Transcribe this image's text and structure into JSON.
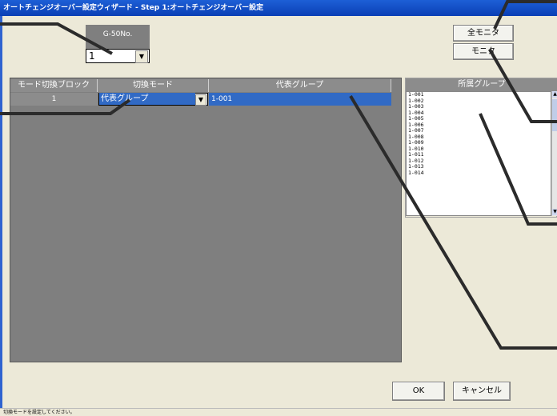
{
  "window": {
    "title": "オートチェンジオーバー設定ウィザード - Step 1:オートチェンジオーバー設定"
  },
  "g50": {
    "label": "G-50No.",
    "selected": "1"
  },
  "buttons": {
    "all_monitor": "全モニタ",
    "monitor": "モニタ",
    "ok": "OK",
    "cancel": "キャンセル"
  },
  "grid": {
    "headers": [
      "モード切換ブロック",
      "切換モード",
      "代表グループ"
    ],
    "rows": [
      {
        "block": "1",
        "mode": "代表グループ",
        "group": "1-001"
      }
    ]
  },
  "group_panel": {
    "header": "所属グループ",
    "items": [
      "1-001",
      "1-002",
      "1-003",
      "1-004",
      "1-005",
      "1-006",
      "1-007",
      "1-008",
      "1-009",
      "1-010",
      "1-011",
      "1-012",
      "1-013",
      "1-014"
    ]
  },
  "status": {
    "text": "切換モードを設定してください。"
  },
  "colors": {
    "title_bar": "#0a3fb5",
    "panel_gray": "#7f7f7f",
    "selection_blue": "#316ac5",
    "window_bg": "#ece9d8"
  }
}
